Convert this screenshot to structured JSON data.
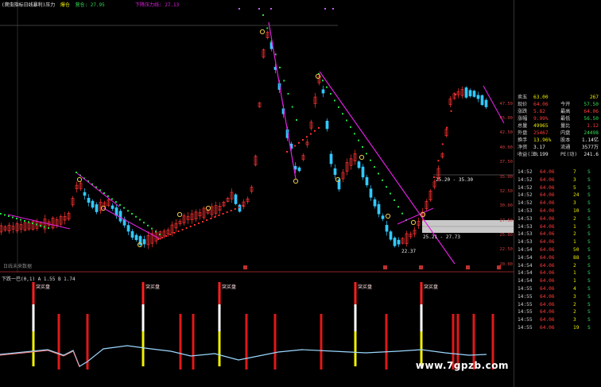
{
  "legend": {
    "label": "(爬虫指标日线暴利)压力",
    "item2": "爆仓",
    "item3": "营仓: 27.95",
    "item4": "下降压力线: 27.13"
  },
  "sub_indicator": {
    "label": "下跌一巴(0,1) A 1.55 B 1.74",
    "signal_label": "突买盘"
  },
  "annotations": {
    "note1": "25.20 - 35.30",
    "note2": "25.21 - 27.73",
    "note3": "22.37",
    "bottom_left": "日线未来数据"
  },
  "price_axis": [
    "47.50",
    "45.00",
    "42.50",
    "40.00",
    "37.50",
    "35.00",
    "32.50",
    "30.00",
    "27.50",
    "25.00",
    "22.50",
    "20.00"
  ],
  "quote": [
    {
      "k": "卖五",
      "v1": "63.00",
      "k2": "",
      "v2": "267",
      "c1": "yellow",
      "c2": "yellow"
    },
    {
      "k": "现价",
      "v1": "64.06",
      "k2": "今开",
      "v2": "57.50",
      "c1": "red",
      "c2": "green"
    },
    {
      "k": "涨跌",
      "v1": "5.82",
      "k2": "最高",
      "v2": "64.06",
      "c1": "red",
      "c2": "red"
    },
    {
      "k": "涨幅",
      "v1": "9.99%",
      "k2": "最低",
      "v2": "56.50",
      "c1": "red",
      "c2": "green"
    },
    {
      "k": "总量",
      "v1": "49965",
      "k2": "量比",
      "v2": "1.12",
      "c1": "yellow",
      "c2": "red"
    },
    {
      "k": "外盘",
      "v1": "25467",
      "k2": "内盘",
      "v2": "24498",
      "c1": "red",
      "c2": "green"
    },
    {
      "k": "换手",
      "v1": "13.96%",
      "k2": "股本",
      "v2": "1.14亿",
      "c1": "yellow",
      "c2": "white"
    },
    {
      "k": "净资",
      "v1": "3.17",
      "k2": "流通",
      "v2": "3577万",
      "c1": "white",
      "c2": "white"
    },
    {
      "k": "收益(三)",
      "v1": "0.199",
      "k2": "PE(动)",
      "v2": "241.6",
      "c1": "white",
      "c2": "white"
    }
  ],
  "ticks": [
    {
      "t": "14:52",
      "p": "64.06",
      "v": "7",
      "d": "S"
    },
    {
      "t": "14:52",
      "p": "64.06",
      "v": "3",
      "d": "S"
    },
    {
      "t": "14:52",
      "p": "64.06",
      "v": "5",
      "d": "S"
    },
    {
      "t": "14:52",
      "p": "64.06",
      "v": "24",
      "d": "S"
    },
    {
      "t": "14:52",
      "p": "64.06",
      "v": "3",
      "d": "S"
    },
    {
      "t": "14:53",
      "p": "64.06",
      "v": "10",
      "d": "S"
    },
    {
      "t": "14:53",
      "p": "64.06",
      "v": "2",
      "d": "S"
    },
    {
      "t": "14:53",
      "p": "64.06",
      "v": "1",
      "d": "S"
    },
    {
      "t": "14:53",
      "p": "64.06",
      "v": "2",
      "d": "S"
    },
    {
      "t": "14:53",
      "p": "64.06",
      "v": "1",
      "d": "S"
    },
    {
      "t": "14:54",
      "p": "64.06",
      "v": "50",
      "d": "S"
    },
    {
      "t": "14:54",
      "p": "64.06",
      "v": "88",
      "d": "S"
    },
    {
      "t": "14:54",
      "p": "64.06",
      "v": "2",
      "d": "S"
    },
    {
      "t": "14:54",
      "p": "64.06",
      "v": "1",
      "d": "S"
    },
    {
      "t": "14:54",
      "p": "64.06",
      "v": "1",
      "d": "S"
    },
    {
      "t": "14:55",
      "p": "64.06",
      "v": "4",
      "d": "S"
    },
    {
      "t": "14:55",
      "p": "64.06",
      "v": "3",
      "d": "S"
    },
    {
      "t": "14:55",
      "p": "64.06",
      "v": "2",
      "d": "S"
    },
    {
      "t": "14:55",
      "p": "64.06",
      "v": "2",
      "d": "S"
    },
    {
      "t": "14:55",
      "p": "64.06",
      "v": "3",
      "d": "S"
    },
    {
      "t": "14:55",
      "p": "64.06",
      "v": "19",
      "d": "S"
    }
  ],
  "watermark": "www.7gpzb.com",
  "colors": {
    "up": "#ff3333",
    "down": "#33c8ff",
    "trend": "#e020e0",
    "dots_green": "#22dd44",
    "dots_red": "#ff3030",
    "ind_line": "#9ad8ff"
  }
}
